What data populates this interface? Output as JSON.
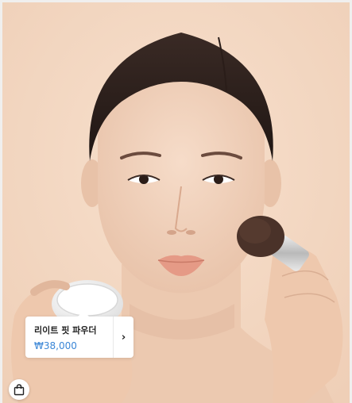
{
  "product_tag": {
    "name": "리이트 핏 파우더",
    "price": "₩38,000",
    "price_color": "#3a86d6",
    "arrow_icon": "chevron-right-icon",
    "arrow_glyph": "›"
  },
  "shop_button": {
    "icon": "shopping-bag-icon"
  },
  "colors": {
    "background": "#f3d8c3"
  }
}
